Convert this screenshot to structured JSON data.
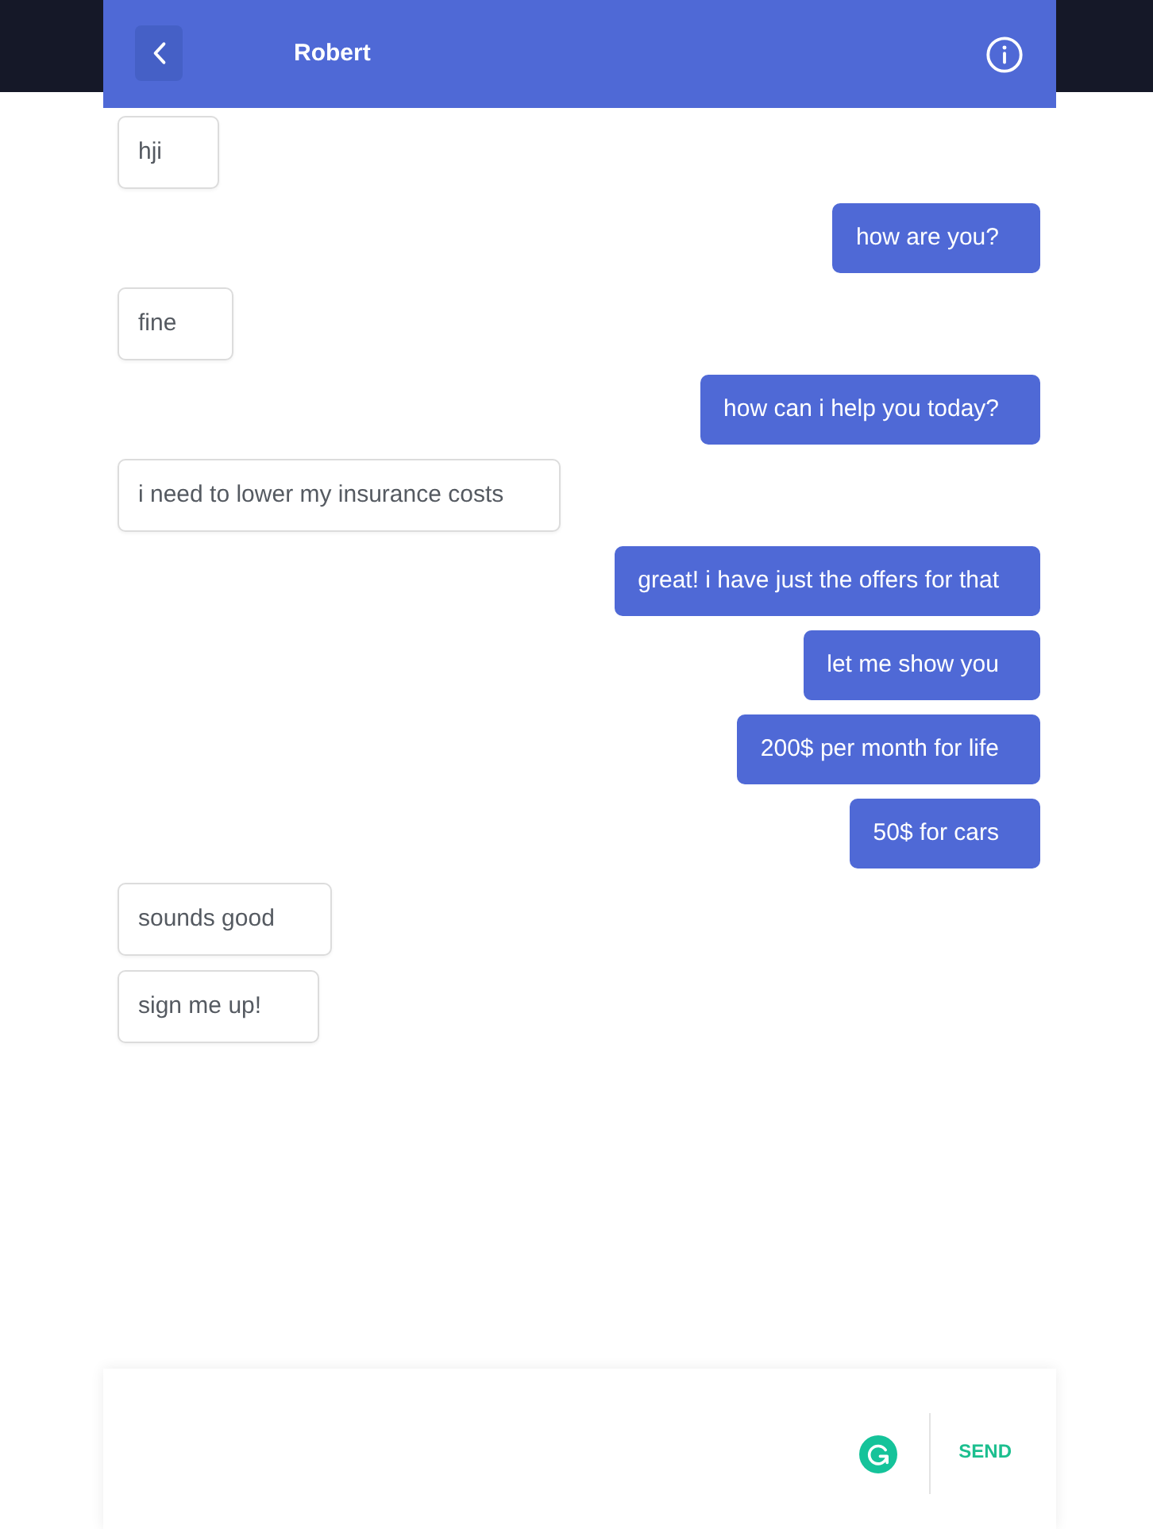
{
  "header": {
    "title": "Robert"
  },
  "messages": [
    {
      "kind": "received",
      "text": "hji"
    },
    {
      "kind": "sent",
      "text": "how are you?"
    },
    {
      "kind": "received",
      "text": "fine"
    },
    {
      "kind": "sent",
      "text": "how can i help you today?"
    },
    {
      "kind": "received",
      "text": "i need to lower my insurance costs"
    },
    {
      "kind": "sent",
      "text": "great! i have just the offers for that"
    },
    {
      "kind": "sent",
      "text": "let me show you"
    },
    {
      "kind": "sent",
      "text": "200$ per month for life"
    },
    {
      "kind": "sent",
      "text": "50$ for cars"
    },
    {
      "kind": "received",
      "text": "sounds good"
    },
    {
      "kind": "received",
      "text": "sign me up!"
    }
  ],
  "composer": {
    "send_label": "SEND"
  }
}
